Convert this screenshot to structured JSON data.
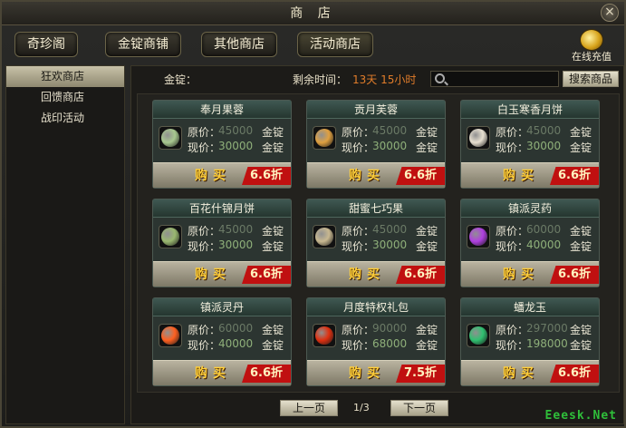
{
  "window": {
    "title": "商 店",
    "close_glyph": "×"
  },
  "tabs": [
    {
      "label": "奇珍阁"
    },
    {
      "label": "金锭商铺"
    },
    {
      "label": "其他商店"
    },
    {
      "label": "活动商店"
    }
  ],
  "recharge": {
    "label": "在线充值",
    "icon": "gold-coins-icon"
  },
  "sidebar": {
    "items": [
      {
        "label": "狂欢商店",
        "active": true
      },
      {
        "label": "回馈商店"
      },
      {
        "label": "战印活动"
      }
    ]
  },
  "infobar": {
    "gold_label": "金锭：",
    "timer_label": "剩余时间：",
    "timer_value": "13天 15小时",
    "search_placeholder": "",
    "search_button": "搜索商品"
  },
  "card_labels": {
    "orig": "原价：",
    "now": "现价：",
    "unit": "金锭",
    "buy": "购买"
  },
  "items": [
    {
      "name": "奉月果蓉",
      "orig": "45000",
      "now": "30000",
      "discount": "6.6折",
      "icon": "mooncake-icon",
      "color": "#a8c890"
    },
    {
      "name": "贡月芙蓉",
      "orig": "45000",
      "now": "30000",
      "discount": "6.6折",
      "icon": "mooncake-icon",
      "color": "#e0a040"
    },
    {
      "name": "白玉寒香月饼",
      "orig": "45000",
      "now": "30000",
      "discount": "6.6折",
      "icon": "mooncake-icon",
      "color": "#e8e0d0"
    },
    {
      "name": "百花什锦月饼",
      "orig": "45000",
      "now": "30000",
      "discount": "6.6折",
      "icon": "mooncake-icon",
      "color": "#9ab870"
    },
    {
      "name": "甜蜜七巧果",
      "orig": "45000",
      "now": "30000",
      "discount": "6.6折",
      "icon": "mooncake-icon",
      "color": "#c8b890"
    },
    {
      "name": "镇派灵药",
      "orig": "60000",
      "now": "40000",
      "discount": "6.6折",
      "icon": "potion-icon",
      "color": "#b040e0"
    },
    {
      "name": "镇派灵丹",
      "orig": "60000",
      "now": "40000",
      "discount": "6.6折",
      "icon": "pill-icon",
      "color": "#ff6020"
    },
    {
      "name": "月度特权礼包",
      "orig": "90000",
      "now": "68000",
      "discount": "7.5折",
      "icon": "gift-pack-icon",
      "color": "#e03010"
    },
    {
      "name": "蟠龙玉",
      "orig": "297000",
      "now": "198000",
      "discount": "6.6折",
      "icon": "jade-icon",
      "color": "#30c070"
    }
  ],
  "pager": {
    "prev": "上一页",
    "page": "1/3",
    "next": "下一页"
  },
  "watermark": "Eeesk.Net"
}
